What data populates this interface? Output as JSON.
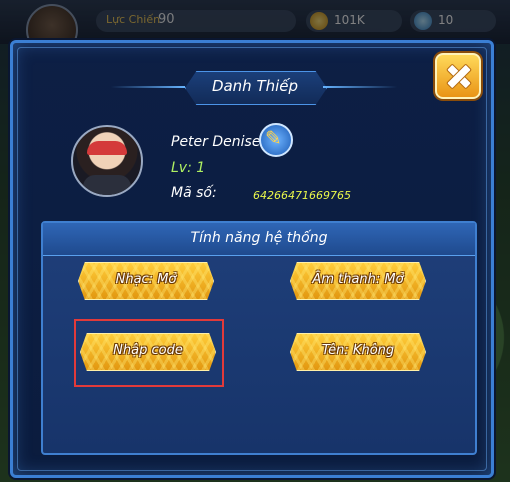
{
  "hud": {
    "power_label": "Lực Chiến",
    "power_value": "90",
    "gold": "101K",
    "gems": "10"
  },
  "dialog": {
    "title": "Danh Thiếp",
    "player": {
      "name": "Peter Denise",
      "level": "Lv: 1",
      "id_label": "Mã số:",
      "id_value": "64266471669765"
    },
    "system_panel": {
      "title": "Tính năng hệ thống",
      "buttons": {
        "music": "Nhạc: Mở",
        "sound": "Âm thanh: Mở",
        "enter_code": "Nhập code",
        "name": "Tên: Không"
      }
    }
  },
  "colors": {
    "dialog_border": "#3b7fd4",
    "button_gold": "#ffcd3a",
    "highlight": "#e23a3a",
    "level_text": "#aef062",
    "id_text": "#e8f74a"
  }
}
